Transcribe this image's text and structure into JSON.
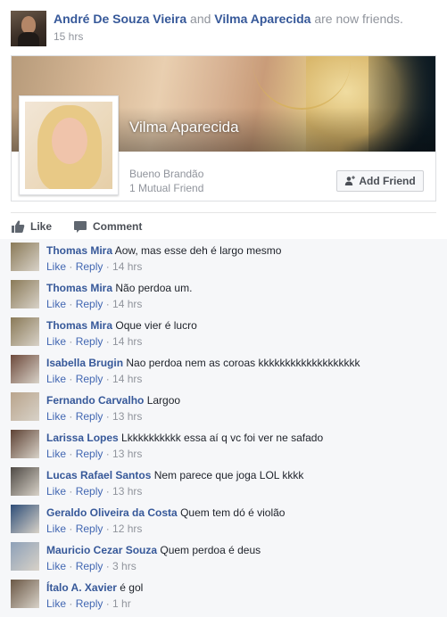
{
  "story": {
    "actor_name": "André De Souza Vieira",
    "connector": " and ",
    "friend_name": "Vilma Aparecida",
    "verb": " are now friends.",
    "timestamp": "15 hrs"
  },
  "attachment": {
    "profile_name": "Vilma Aparecida",
    "location": "Bueno Brandão",
    "mutual": "1 Mutual Friend",
    "add_friend_label": "Add Friend"
  },
  "actions": {
    "like_label": "Like",
    "comment_label": "Comment"
  },
  "comments": [
    {
      "author": "Thomas Mira",
      "text": "Aow, mas esse deh é largo mesmo",
      "like": "Like",
      "reply": "Reply",
      "time": "14 hrs",
      "avatar_color": "#8a7a58"
    },
    {
      "author": "Thomas Mira",
      "text": "Não perdoa um.",
      "like": "Like",
      "reply": "Reply",
      "time": "14 hrs",
      "avatar_color": "#8a7a58"
    },
    {
      "author": "Thomas Mira",
      "text": "Oque vier é lucro",
      "like": "Like",
      "reply": "Reply",
      "time": "14 hrs",
      "avatar_color": "#8a7a58"
    },
    {
      "author": "Isabella Brugin",
      "text": "Nao perdoa nem as coroas kkkkkkkkkkkkkkkkkkk",
      "like": "Like",
      "reply": "Reply",
      "time": "14 hrs",
      "avatar_color": "#6e4a3c"
    },
    {
      "author": "Fernando Carvalho",
      "text": "Largoo",
      "like": "Like",
      "reply": "Reply",
      "time": "13 hrs",
      "avatar_color": "#b9a48c"
    },
    {
      "author": "Larissa Lopes",
      "text": "Lkkkkkkkkkk essa aí q vc foi ver ne safado",
      "like": "Like",
      "reply": "Reply",
      "time": "13 hrs",
      "avatar_color": "#5e4234"
    },
    {
      "author": "Lucas Rafael Santos",
      "text": "Nem parece que joga LOL kkkk",
      "like": "Like",
      "reply": "Reply",
      "time": "13 hrs",
      "avatar_color": "#4f4a45"
    },
    {
      "author": "Geraldo Oliveira da Costa",
      "text": "Quem tem dó é violão",
      "like": "Like",
      "reply": "Reply",
      "time": "12 hrs",
      "avatar_color": "#2e4e78"
    },
    {
      "author": "Mauricio Cezar Souza",
      "text": "Quem perdoa é deus",
      "like": "Like",
      "reply": "Reply",
      "time": "3 hrs",
      "avatar_color": "#8da0b8"
    },
    {
      "author": "Ítalo A. Xavier",
      "text": "é gol",
      "like": "Like",
      "reply": "Reply",
      "time": "1 hr",
      "avatar_color": "#6b5846"
    }
  ],
  "colors": {
    "link": "#365899",
    "meta": "#90949c",
    "action_blue": "#4267b2"
  }
}
